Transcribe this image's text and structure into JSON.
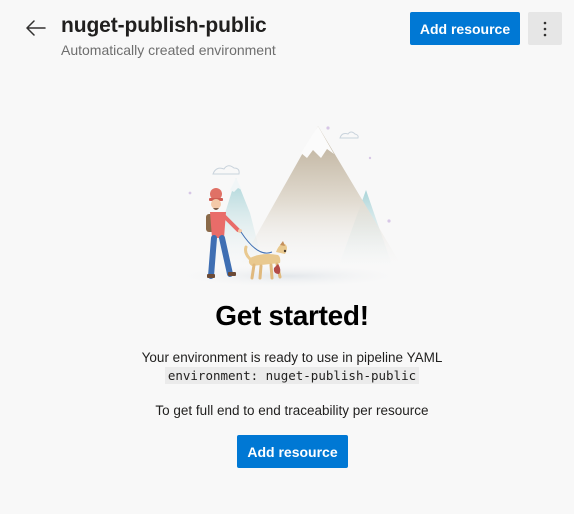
{
  "header": {
    "title": "nuget-publish-public",
    "subtitle": "Automatically created environment",
    "add_resource_label": "Add resource",
    "icons": {
      "back": "arrow-left-icon",
      "more": "more-vertical-icon"
    }
  },
  "empty_state": {
    "heading": "Get started!",
    "description": "Your environment is ready to use in pipeline YAML",
    "yaml_snippet": "environment: nuget-publish-public",
    "traceability_text": "To get full end to end traceability per resource",
    "add_resource_label": "Add resource",
    "illustration": "hiker-with-dog-mountains-illustration"
  },
  "colors": {
    "accent": "#0078d4",
    "background": "#f8f8f8"
  }
}
